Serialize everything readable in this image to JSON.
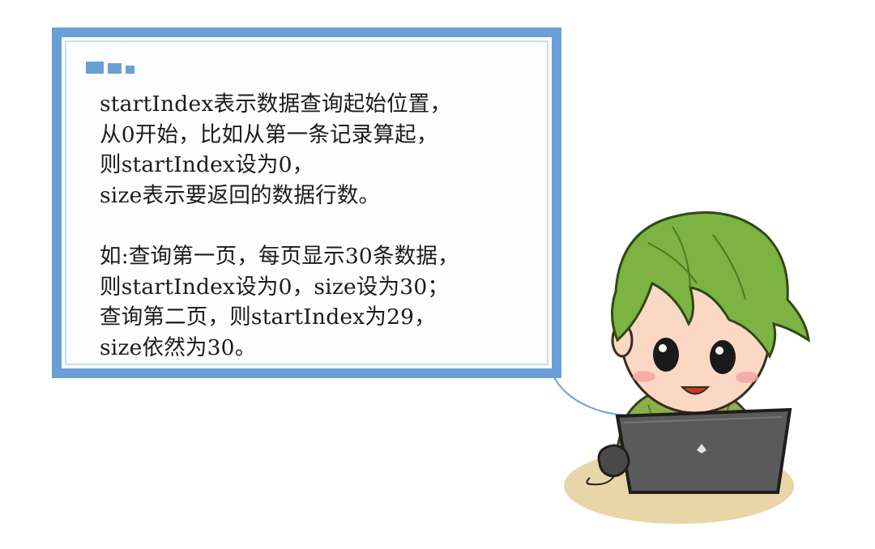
{
  "bubble": {
    "paragraph1": [
      "startIndex表示数据查询起始位置，",
      "从0开始，比如从第一条记录算起，",
      "则startIndex设为0，",
      "size表示要返回的数据行数。"
    ],
    "paragraph2": [
      "如:查询第一页，每页显示30条数据，",
      "则startIndex设为0，size设为30；",
      "查询第二页，则startIndex为29，",
      "size依然为30。"
    ]
  },
  "colors": {
    "bubble_border": "#6a9fd6",
    "hair": "#7cb342",
    "laptop": "#5a5a5a",
    "shirt": "#8bb048"
  },
  "icons": [
    "window-dots-icon",
    "cartoon-character",
    "laptop-icon",
    "computer-mouse-icon"
  ]
}
